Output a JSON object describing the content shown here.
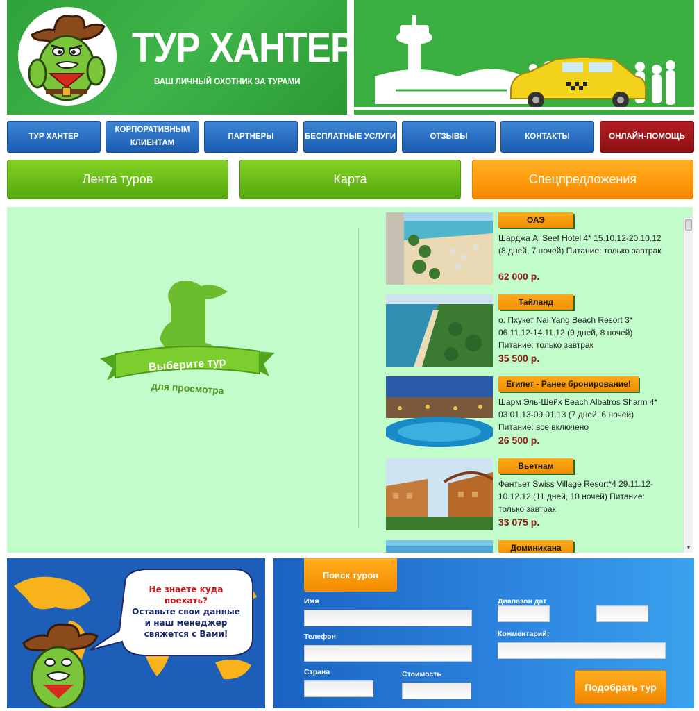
{
  "header": {
    "title": "ТУР ХАНТЕР",
    "subtitle": "ВАШ ЛИЧНЫЙ ОХОТНИК ЗА ТУРАМИ"
  },
  "nav": [
    {
      "label": "ТУР ХАНТЕР"
    },
    {
      "label": "КОРПОРАТИВНЫМ КЛИЕНТАМ"
    },
    {
      "label": "ПАРТНЕРЫ"
    },
    {
      "label": "БЕСПЛАТНЫЕ УСЛУГИ"
    },
    {
      "label": "ОТЗЫВЫ"
    },
    {
      "label": "КОНТАКТЫ"
    },
    {
      "label": "ОНЛАЙН-ПОМОЩЬ"
    }
  ],
  "tabs": [
    {
      "label": "Лента туров"
    },
    {
      "label": "Карта"
    },
    {
      "label": "Спецпредложения"
    }
  ],
  "viewer": {
    "line1": "Выберите тур",
    "line2": "для просмотра"
  },
  "tours": [
    {
      "country": "ОАЭ",
      "desc": "Шарджа Al Seef Hotel 4* 15.10.12-20.10.12 (8 дней, 7 ночей) Питание: только завтрак",
      "price": "62 000 р."
    },
    {
      "country": "Тайланд",
      "desc": "о. Пхукет Nai Yang Beach Resort 3* 06.11.12-14.11.12 (9 дней, 8 ночей) Питание: только завтрак",
      "price": "35 500 р."
    },
    {
      "country": "Египет - Ранее бронирование!",
      "desc": "Шарм Эль-Шейх Beach Albatros Sharm 4* 03.01.13-09.01.13 (7 дней, 6 ночей) Питание: все включено",
      "price": "26 500 р."
    },
    {
      "country": "Вьетнам",
      "desc": "Фантьет Swiss Village Resort*4 29.11.12-10.12.12 (11 дней, 10 ночей) Питание: только завтрак",
      "price": "33 075 р."
    },
    {
      "country": "Доминикана",
      "desc": "",
      "price": ""
    }
  ],
  "promo": {
    "line1": "Не знаете куда поехать?",
    "line2": "Оставьте свои данные",
    "line3": "и наш менеджер",
    "line4": "свяжется с Вами!"
  },
  "form": {
    "tab": "Поиск туров",
    "name_label": "Имя",
    "phone_label": "Телефон",
    "country_label": "Страна",
    "cost_label": "Стоимость",
    "dates_label": "Диапазон дат",
    "comment_label": "Комментарий:",
    "submit": "Подобрать тур"
  },
  "colors": {
    "nav_blue": "#2a6fc4",
    "help_red": "#a0161b",
    "tab_green": "#6bbd1a",
    "tab_orange": "#ff9c0c",
    "panel_green": "#c2fccb",
    "price_red": "#8a1a14"
  }
}
